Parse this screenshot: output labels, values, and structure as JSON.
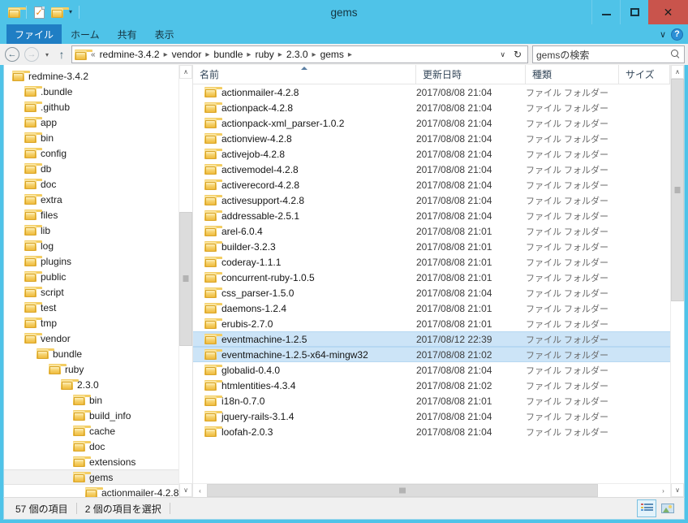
{
  "window": {
    "title": "gems",
    "controls": {
      "minimize": "—",
      "maximize": "□",
      "close": "✕"
    }
  },
  "quick_access": {
    "items": [
      {
        "name": "folder-icon",
        "label": ""
      },
      {
        "name": "new-item-icon",
        "label": ""
      },
      {
        "name": "properties-folder-icon",
        "label": ""
      }
    ],
    "caret": "▾"
  },
  "ribbon": {
    "tabs": [
      {
        "label": "ファイル",
        "active": true
      },
      {
        "label": "ホーム",
        "active": false
      },
      {
        "label": "共有",
        "active": false
      },
      {
        "label": "表示",
        "active": false
      }
    ],
    "expand_caret": "∨",
    "help_label": "?"
  },
  "address_bar": {
    "back": "←",
    "forward": "→",
    "history_caret": "▾",
    "up": "↑",
    "path_prefix": "«",
    "crumbs": [
      "redmine-3.4.2",
      "vendor",
      "bundle",
      "ruby",
      "2.3.0",
      "gems"
    ],
    "separator": "▸",
    "dropdown_caret": "∨",
    "refresh": "↻"
  },
  "search": {
    "placeholder": "gemsの検索",
    "icon": "search-icon"
  },
  "nav_pane": {
    "tree": [
      {
        "label": "redmine-3.4.2",
        "depth": 1,
        "selected": false
      },
      {
        "label": ".bundle",
        "depth": 2,
        "selected": false
      },
      {
        "label": ".github",
        "depth": 2,
        "selected": false
      },
      {
        "label": "app",
        "depth": 2,
        "selected": false
      },
      {
        "label": "bin",
        "depth": 2,
        "selected": false
      },
      {
        "label": "config",
        "depth": 2,
        "selected": false
      },
      {
        "label": "db",
        "depth": 2,
        "selected": false
      },
      {
        "label": "doc",
        "depth": 2,
        "selected": false
      },
      {
        "label": "extra",
        "depth": 2,
        "selected": false
      },
      {
        "label": "files",
        "depth": 2,
        "selected": false
      },
      {
        "label": "lib",
        "depth": 2,
        "selected": false
      },
      {
        "label": "log",
        "depth": 2,
        "selected": false
      },
      {
        "label": "plugins",
        "depth": 2,
        "selected": false
      },
      {
        "label": "public",
        "depth": 2,
        "selected": false
      },
      {
        "label": "script",
        "depth": 2,
        "selected": false
      },
      {
        "label": "test",
        "depth": 2,
        "selected": false
      },
      {
        "label": "tmp",
        "depth": 2,
        "selected": false
      },
      {
        "label": "vendor",
        "depth": 2,
        "selected": false
      },
      {
        "label": "bundle",
        "depth": 3,
        "selected": false
      },
      {
        "label": "ruby",
        "depth": 4,
        "selected": false
      },
      {
        "label": "2.3.0",
        "depth": 5,
        "selected": false
      },
      {
        "label": "bin",
        "depth": 6,
        "selected": false
      },
      {
        "label": "build_info",
        "depth": 6,
        "selected": false
      },
      {
        "label": "cache",
        "depth": 6,
        "selected": false
      },
      {
        "label": "doc",
        "depth": 6,
        "selected": false
      },
      {
        "label": "extensions",
        "depth": 6,
        "selected": false
      },
      {
        "label": "gems",
        "depth": 6,
        "selected": true
      },
      {
        "label": "actionmailer-4.2.8",
        "depth": 7,
        "selected": false
      }
    ],
    "scroll_up": "∧",
    "scroll_down": "∨"
  },
  "file_list": {
    "columns": [
      {
        "key": "name",
        "label": "名前",
        "sorted": "asc"
      },
      {
        "key": "date",
        "label": "更新日時",
        "sorted": ""
      },
      {
        "key": "type",
        "label": "種類",
        "sorted": ""
      },
      {
        "key": "size",
        "label": "サイズ",
        "sorted": ""
      }
    ],
    "rows": [
      {
        "name": "actionmailer-4.2.8",
        "date": "2017/08/08 21:04",
        "type": "ファイル フォルダー",
        "size": "",
        "selected": false
      },
      {
        "name": "actionpack-4.2.8",
        "date": "2017/08/08 21:04",
        "type": "ファイル フォルダー",
        "size": "",
        "selected": false
      },
      {
        "name": "actionpack-xml_parser-1.0.2",
        "date": "2017/08/08 21:04",
        "type": "ファイル フォルダー",
        "size": "",
        "selected": false
      },
      {
        "name": "actionview-4.2.8",
        "date": "2017/08/08 21:04",
        "type": "ファイル フォルダー",
        "size": "",
        "selected": false
      },
      {
        "name": "activejob-4.2.8",
        "date": "2017/08/08 21:04",
        "type": "ファイル フォルダー",
        "size": "",
        "selected": false
      },
      {
        "name": "activemodel-4.2.8",
        "date": "2017/08/08 21:04",
        "type": "ファイル フォルダー",
        "size": "",
        "selected": false
      },
      {
        "name": "activerecord-4.2.8",
        "date": "2017/08/08 21:04",
        "type": "ファイル フォルダー",
        "size": "",
        "selected": false
      },
      {
        "name": "activesupport-4.2.8",
        "date": "2017/08/08 21:04",
        "type": "ファイル フォルダー",
        "size": "",
        "selected": false
      },
      {
        "name": "addressable-2.5.1",
        "date": "2017/08/08 21:04",
        "type": "ファイル フォルダー",
        "size": "",
        "selected": false
      },
      {
        "name": "arel-6.0.4",
        "date": "2017/08/08 21:01",
        "type": "ファイル フォルダー",
        "size": "",
        "selected": false
      },
      {
        "name": "builder-3.2.3",
        "date": "2017/08/08 21:01",
        "type": "ファイル フォルダー",
        "size": "",
        "selected": false
      },
      {
        "name": "coderay-1.1.1",
        "date": "2017/08/08 21:01",
        "type": "ファイル フォルダー",
        "size": "",
        "selected": false
      },
      {
        "name": "concurrent-ruby-1.0.5",
        "date": "2017/08/08 21:01",
        "type": "ファイル フォルダー",
        "size": "",
        "selected": false
      },
      {
        "name": "css_parser-1.5.0",
        "date": "2017/08/08 21:04",
        "type": "ファイル フォルダー",
        "size": "",
        "selected": false
      },
      {
        "name": "daemons-1.2.4",
        "date": "2017/08/08 21:01",
        "type": "ファイル フォルダー",
        "size": "",
        "selected": false
      },
      {
        "name": "erubis-2.7.0",
        "date": "2017/08/08 21:01",
        "type": "ファイル フォルダー",
        "size": "",
        "selected": false
      },
      {
        "name": "eventmachine-1.2.5",
        "date": "2017/08/12 22:39",
        "type": "ファイル フォルダー",
        "size": "",
        "selected": true
      },
      {
        "name": "eventmachine-1.2.5-x64-mingw32",
        "date": "2017/08/08 21:02",
        "type": "ファイル フォルダー",
        "size": "",
        "selected": true
      },
      {
        "name": "globalid-0.4.0",
        "date": "2017/08/08 21:04",
        "type": "ファイル フォルダー",
        "size": "",
        "selected": false
      },
      {
        "name": "htmlentities-4.3.4",
        "date": "2017/08/08 21:02",
        "type": "ファイル フォルダー",
        "size": "",
        "selected": false
      },
      {
        "name": "i18n-0.7.0",
        "date": "2017/08/08 21:01",
        "type": "ファイル フォルダー",
        "size": "",
        "selected": false
      },
      {
        "name": "jquery-rails-3.1.4",
        "date": "2017/08/08 21:04",
        "type": "ファイル フォルダー",
        "size": "",
        "selected": false
      },
      {
        "name": "loofah-2.0.3",
        "date": "2017/08/08 21:04",
        "type": "ファイル フォルダー",
        "size": "",
        "selected": false
      }
    ],
    "scroll_up": "∧",
    "scroll_down": "∨",
    "hscroll_left": "‹",
    "hscroll_right": "›"
  },
  "status_bar": {
    "item_count": "57 個の項目",
    "selection_count": "2 個の項目を選択",
    "views": [
      {
        "name": "details-view",
        "active": true
      },
      {
        "name": "large-icons-view",
        "active": false
      }
    ]
  },
  "colors": {
    "titlebar": "#4fc3e8",
    "file_tab": "#1f7ec4",
    "close_button": "#c9544c",
    "selection": "#cce4f7",
    "tree_selection": "#f2f2f2"
  }
}
